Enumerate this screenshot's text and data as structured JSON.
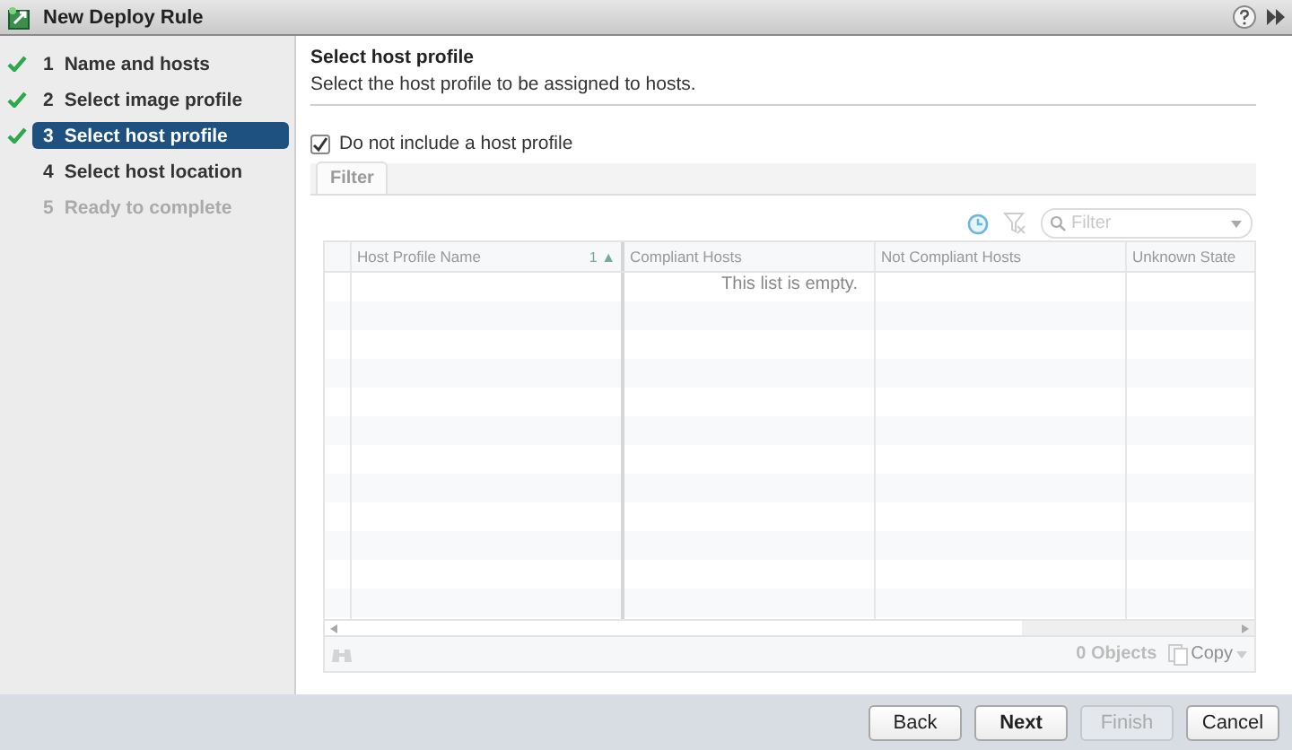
{
  "window": {
    "title": "New Deploy Rule"
  },
  "steps": [
    {
      "number": "1",
      "label": "Name and hosts",
      "completed": true,
      "selected": false,
      "disabled": false
    },
    {
      "number": "2",
      "label": "Select image profile",
      "completed": true,
      "selected": false,
      "disabled": false
    },
    {
      "number": "3",
      "label": "Select host profile",
      "completed": true,
      "selected": true,
      "disabled": false
    },
    {
      "number": "4",
      "label": "Select host location",
      "completed": false,
      "selected": false,
      "disabled": false
    },
    {
      "number": "5",
      "label": "Ready to complete",
      "completed": false,
      "selected": false,
      "disabled": true
    }
  ],
  "page": {
    "title": "Select host profile",
    "subtitle": "Select the host profile to be assigned to hosts."
  },
  "checkbox": {
    "label": "Do not include a host profile",
    "checked": true
  },
  "tabs": [
    {
      "label": "Filter",
      "selected": true
    }
  ],
  "table": {
    "filter_placeholder": "Filter",
    "columns": [
      {
        "label": "Host Profile Name",
        "sort": "1 ▲"
      },
      {
        "label": "Compliant Hosts"
      },
      {
        "label": "Not Compliant Hosts"
      },
      {
        "label": "Unknown State"
      }
    ],
    "empty_message": "This list is empty.",
    "object_count": "0 Objects",
    "copy_label": "Copy"
  },
  "buttons": [
    {
      "label": "Back",
      "primary": false,
      "disabled": false
    },
    {
      "label": "Next",
      "primary": true,
      "disabled": false
    },
    {
      "label": "Finish",
      "primary": false,
      "disabled": true
    },
    {
      "label": "Cancel",
      "primary": false,
      "disabled": false
    }
  ]
}
